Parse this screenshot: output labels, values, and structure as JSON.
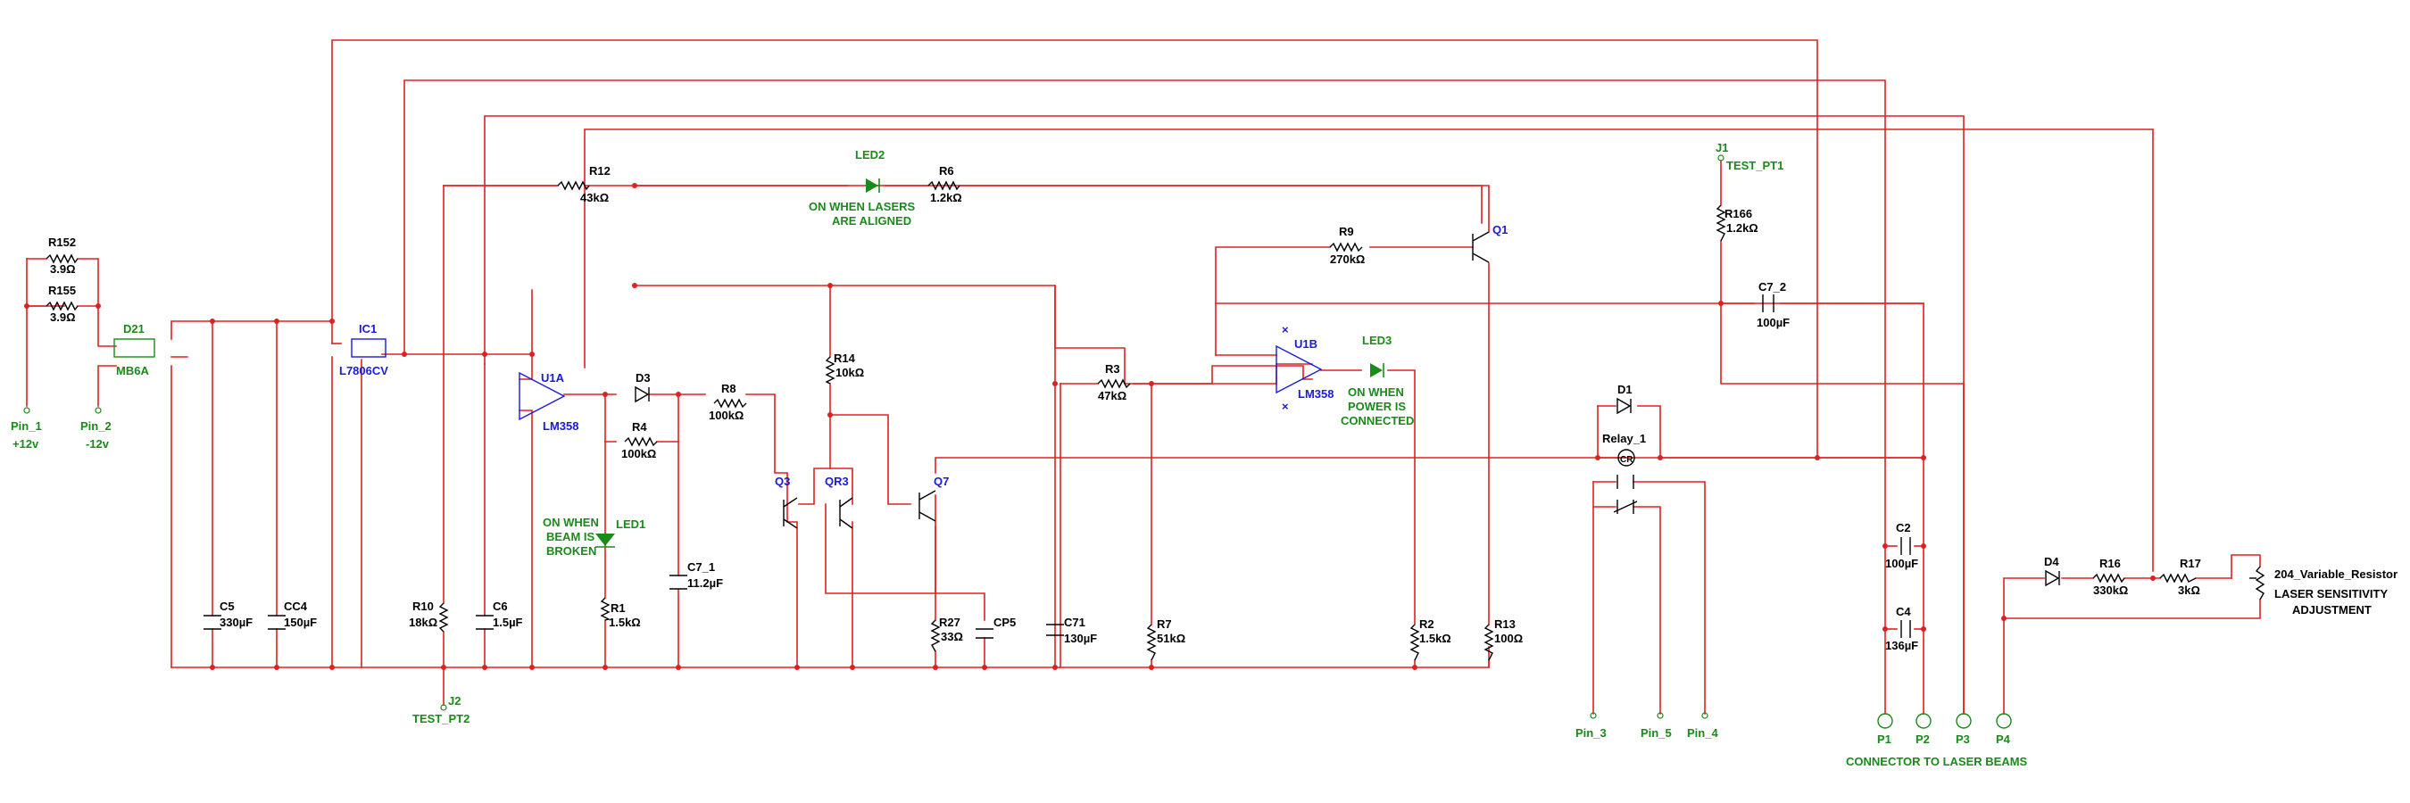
{
  "ports": {
    "pin1": {
      "name": "Pin_1",
      "sub": "+12v"
    },
    "pin2": {
      "name": "Pin_2",
      "sub": "-12v"
    },
    "pin3": "Pin_3",
    "pin4": "Pin_4",
    "pin5": "Pin_5",
    "j1": {
      "name": "J1",
      "sub": "TEST_PT1"
    },
    "j2": {
      "name": "J2",
      "sub": "TEST_PT2"
    },
    "p1": "P1",
    "p2": "P2",
    "p3": "P3",
    "p4": "P4",
    "connector_note": "CONNECTOR TO LASER BEAMS"
  },
  "resistors": {
    "r152": {
      "ref": "R152",
      "val": "3.9Ω"
    },
    "r155": {
      "ref": "R155",
      "val": "3.9Ω"
    },
    "r12": {
      "ref": "R12",
      "val": "43kΩ"
    },
    "r6": {
      "ref": "R6",
      "val": "1.2kΩ"
    },
    "r8": {
      "ref": "R8",
      "val": "100kΩ"
    },
    "r4": {
      "ref": "R4",
      "val": "100kΩ"
    },
    "r14": {
      "ref": "R14",
      "val": "10kΩ"
    },
    "r3": {
      "ref": "R3",
      "val": "47kΩ"
    },
    "r9": {
      "ref": "R9",
      "val": "270kΩ"
    },
    "r166": {
      "ref": "R166",
      "val": "1.2kΩ"
    },
    "r10": {
      "ref": "R10",
      "val": "18kΩ"
    },
    "r1": {
      "ref": "R1",
      "val": "1.5kΩ"
    },
    "r27": {
      "ref": "R27",
      "val": "33Ω"
    },
    "r7": {
      "ref": "R7",
      "val": "51kΩ"
    },
    "r2": {
      "ref": "R2",
      "val": "1.5kΩ"
    },
    "r13": {
      "ref": "R13",
      "val": "100Ω"
    },
    "r16": {
      "ref": "R16",
      "val": "330kΩ"
    },
    "r17": {
      "ref": "R17",
      "val": "3kΩ"
    }
  },
  "capacitors": {
    "c5": {
      "ref": "C5",
      "val": "330µF"
    },
    "cc4": {
      "ref": "CC4",
      "val": "150µF"
    },
    "c6": {
      "ref": "C6",
      "val": "1.5µF"
    },
    "c7_1": {
      "ref": "C7_1",
      "val": "11.2µF"
    },
    "cp5": {
      "ref": "CP5",
      "val": ""
    },
    "c71": {
      "ref": "C71",
      "val": "130µF"
    },
    "c7_2": {
      "ref": "C7_2",
      "val": "100µF"
    },
    "c2": {
      "ref": "C2",
      "val": "100µF"
    },
    "c4": {
      "ref": "C4",
      "val": "136µF"
    }
  },
  "semis": {
    "d21": {
      "ref": "D21",
      "val": "MB6A"
    },
    "ic1": {
      "ref": "IC1",
      "val": "L7806CV"
    },
    "u1a": {
      "ref": "U1A",
      "val": "LM358"
    },
    "u1b": {
      "ref": "U1B",
      "val": "LM358"
    },
    "d3": "D3",
    "d1": "D1",
    "d4": "D4",
    "q1": "Q1",
    "q3": "Q3",
    "qr3": "QR3",
    "q7": "Q7",
    "relay": "Relay_1",
    "variable_resistor": "204_Variable_Resistor"
  },
  "leds": {
    "led1": {
      "ref": "LED1",
      "note": [
        "ON WHEN",
        "BEAM IS",
        "BROKEN"
      ]
    },
    "led2": {
      "ref": "LED2",
      "note": [
        "ON WHEN LASERS",
        "ARE ALIGNED"
      ]
    },
    "led3": {
      "ref": "LED3",
      "note": [
        "ON WHEN",
        "POWER IS",
        "CONNECTED"
      ]
    }
  },
  "notes": {
    "sensitivity": [
      "LASER SENSITIVITY",
      "ADJUSTMENT"
    ]
  },
  "colors": {
    "wire": "#e02020",
    "ic_label": "#1a1ad8",
    "port_label": "#1a8a1a",
    "component": "#000000"
  }
}
